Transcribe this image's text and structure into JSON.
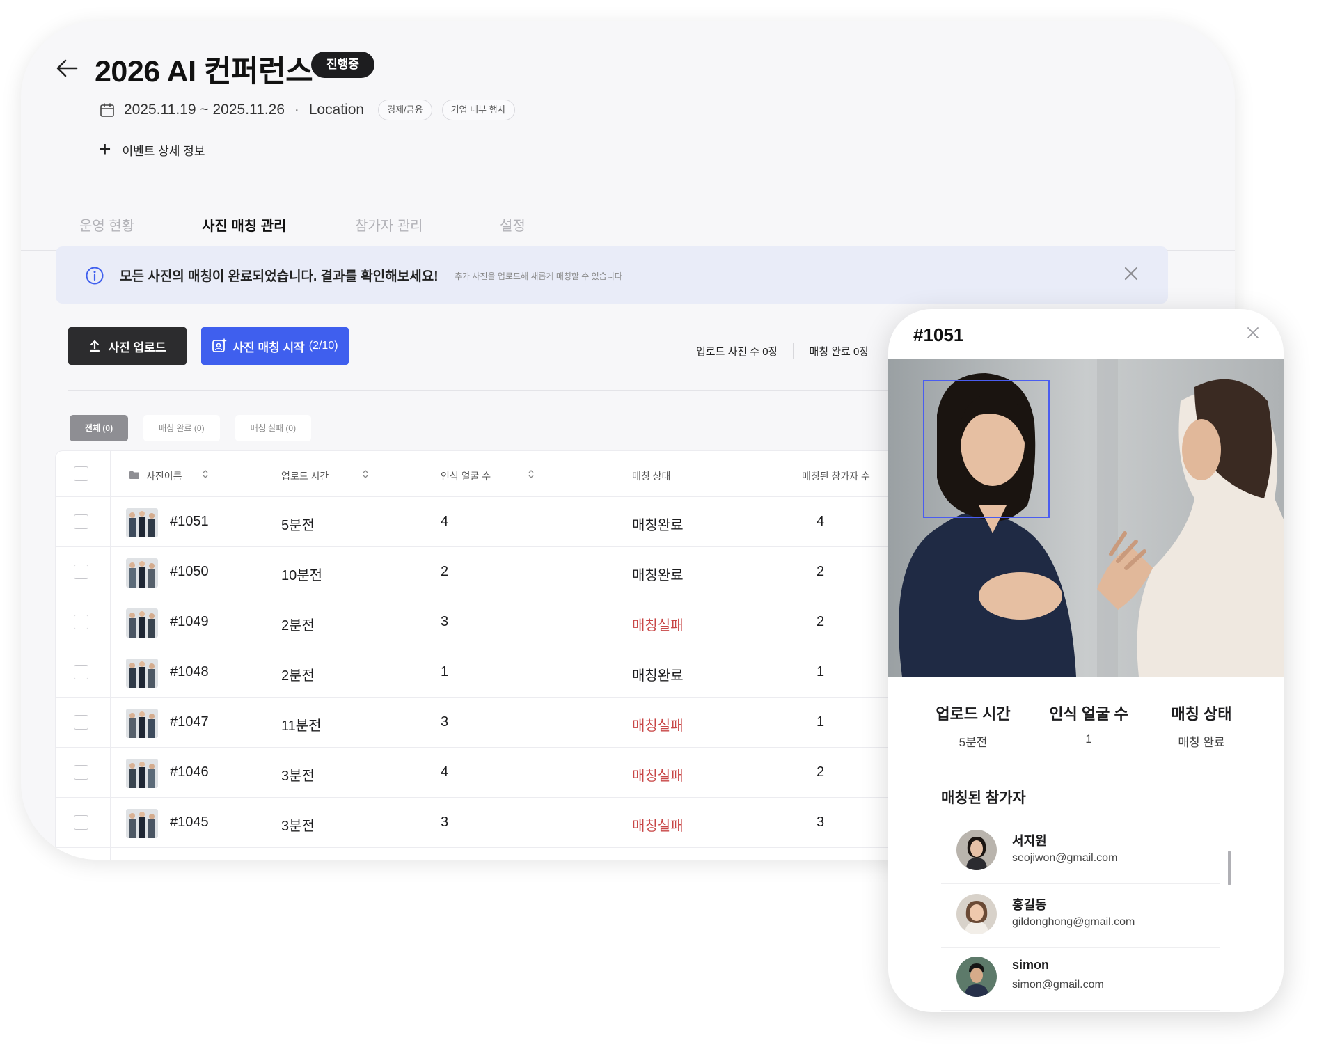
{
  "event": {
    "title": "2026 AI 컨퍼런스",
    "status": "진행중",
    "date_range": "2025.11.19 ~ 2025.11.26",
    "separator": "·",
    "location": "Location",
    "tags": [
      "경제/금융",
      "기업 내부 행사"
    ],
    "detail_link": "이벤트 상세 정보"
  },
  "tabs": [
    {
      "label": "운영 현황",
      "active": false
    },
    {
      "label": "사진 매칭 관리",
      "active": true
    },
    {
      "label": "참가자 관리",
      "active": false
    },
    {
      "label": "설정",
      "active": false
    }
  ],
  "banner": {
    "message": "모든 사진의 매칭이 완료되었습니다. 결과를 확인해보세요!",
    "sub": "추가 사진을 업로드해 새롭게 매칭할 수 있습니다"
  },
  "actions": {
    "upload_label": "사진 업로드",
    "match_label": "사진 매칭 시작",
    "match_count": "(2/10)"
  },
  "stats": {
    "uploaded": "업로드 사진 수 0장",
    "matched": "매칭 완료 0장"
  },
  "filters": [
    {
      "label": "전체 (0)",
      "active": true
    },
    {
      "label": "매칭 완료 (0)",
      "active": false
    },
    {
      "label": "매칭 실패 (0)",
      "active": false
    }
  ],
  "table": {
    "columns": [
      "사진이름",
      "업로드 시간",
      "인식 얼굴 수",
      "매칭 상태",
      "매칭된 참가자 수"
    ],
    "rows": [
      {
        "name": "#1051",
        "time": "5분전",
        "faces": "4",
        "status": "매칭완료",
        "fail": false,
        "matched": "4"
      },
      {
        "name": "#1050",
        "time": "10분전",
        "faces": "2",
        "status": "매칭완료",
        "fail": false,
        "matched": "2"
      },
      {
        "name": "#1049",
        "time": "2분전",
        "faces": "3",
        "status": "매칭실패",
        "fail": true,
        "matched": "2"
      },
      {
        "name": "#1048",
        "time": "2분전",
        "faces": "1",
        "status": "매칭완료",
        "fail": false,
        "matched": "1"
      },
      {
        "name": "#1047",
        "time": "11분전",
        "faces": "3",
        "status": "매칭실패",
        "fail": true,
        "matched": "1"
      },
      {
        "name": "#1046",
        "time": "3분전",
        "faces": "4",
        "status": "매칭실패",
        "fail": true,
        "matched": "2"
      },
      {
        "name": "#1045",
        "time": "3분전",
        "faces": "3",
        "status": "매칭실패",
        "fail": true,
        "matched": "3"
      }
    ]
  },
  "panel": {
    "title": "#1051",
    "meta": [
      {
        "label": "업로드 시간",
        "value": "5분전"
      },
      {
        "label": "인식 얼굴 수",
        "value": "1"
      },
      {
        "label": "매칭 상태",
        "value": "매칭 완료"
      }
    ],
    "section_title": "매칭된 참가자",
    "participants": [
      {
        "name": "서지원",
        "email": "seojiwon@gmail.com"
      },
      {
        "name": "홍길동",
        "email": "gildonghong@gmail.com"
      },
      {
        "name": "simon",
        "email": "simon@gmail.com"
      }
    ]
  },
  "colors": {
    "primary": "#3f5fee",
    "dark": "#2c2c2e",
    "fail": "#c84646",
    "banner_bg": "#e9ecf8"
  },
  "icons": [
    "arrow-left-icon",
    "calendar-icon",
    "plus-icon",
    "info-icon",
    "close-icon",
    "upload-icon",
    "face-scan-icon",
    "folder-icon",
    "sort-icon"
  ]
}
